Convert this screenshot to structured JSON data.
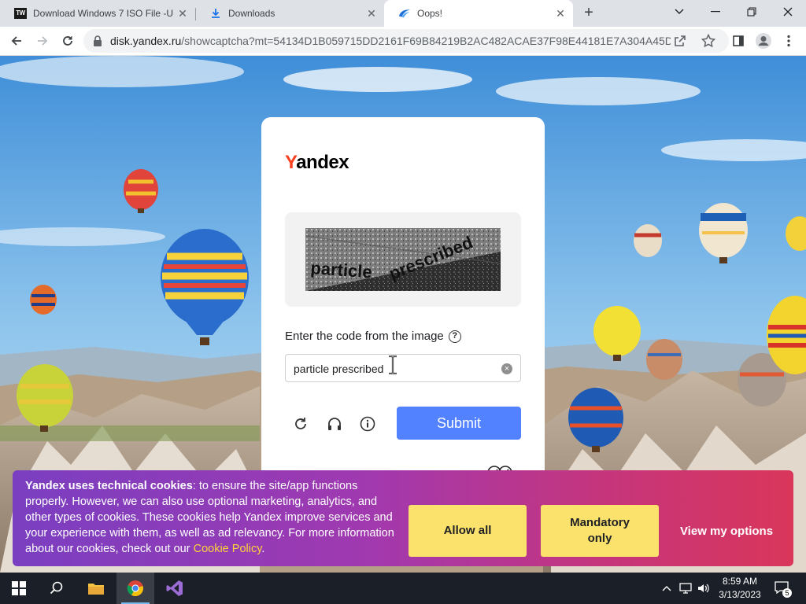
{
  "browser": {
    "tabs": [
      {
        "title": "Download Windows 7 ISO File -U",
        "favicon": "tw-icon",
        "favicon_text": "TW"
      },
      {
        "title": "Downloads",
        "favicon": "download-icon"
      },
      {
        "title": "Oops!",
        "favicon": "yandex-disk-icon",
        "active": true
      }
    ],
    "url_host": "disk.yandex.ru",
    "url_path": "/showcaptcha?mt=54134D1B059715DD2161F69B84219B2AC482ACAE37F98E44181E7A304A45DA..."
  },
  "captcha": {
    "logo_first": "Y",
    "logo_rest": "andex",
    "image_text_1": "particle",
    "image_text_2": "prescribed",
    "prompt": "Enter the code from the image",
    "help_glyph": "?",
    "input_value": "particle prescribed",
    "submit_label": "Submit"
  },
  "cookie": {
    "bold_text": "Yandex uses technical cookies",
    "body_text": ": to ensure the site/app functions properly. However, we can also use optional marketing, analytics, and other types of cookies. These cookies help Yandex improve services and your experience with them, as well as ad relevancy. For more information about our cookies, check out our ",
    "link_text": "Cookie Policy",
    "end_text": ".",
    "allow_label": "Allow all",
    "mandatory_label": "Mandatory only",
    "view_label": "View my options"
  },
  "taskbar": {
    "time": "8:59 AM",
    "date": "3/13/2023",
    "notification_count": "5"
  },
  "colors": {
    "brand_red": "#fc3f1d",
    "submit_blue": "#5282ff",
    "cookie_button": "#fbe26c",
    "cookie_link": "#ffd33a"
  }
}
